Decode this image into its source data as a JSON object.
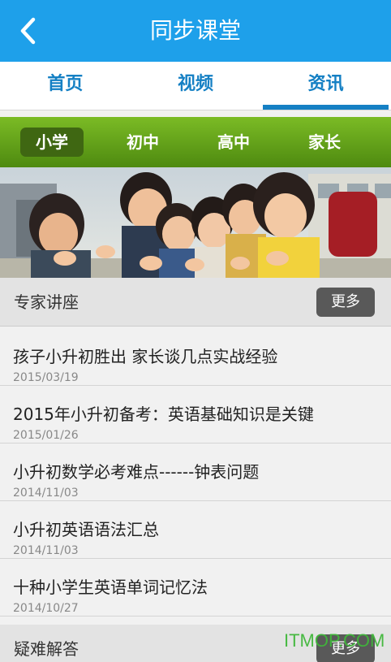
{
  "header": {
    "title": "同步课堂",
    "back_icon": "chevron-left-icon"
  },
  "tabs": [
    {
      "label": "首页",
      "active": false
    },
    {
      "label": "视频",
      "active": false
    },
    {
      "label": "资讯",
      "active": true
    }
  ],
  "segments": [
    {
      "label": "小学",
      "active": true
    },
    {
      "label": "初中",
      "active": false
    },
    {
      "label": "高中",
      "active": false
    },
    {
      "label": "家长",
      "active": false
    }
  ],
  "sections": {
    "expert": {
      "label": "专家讲座",
      "more_label": "更多"
    },
    "qa": {
      "label": "疑难解答",
      "more_label": "更多"
    }
  },
  "news": [
    {
      "title": "孩子小升初胜出 家长谈几点实战经验",
      "date": "2015/03/19"
    },
    {
      "title": "2015年小升初备考：英语基础知识是关键",
      "date": "2015/01/26"
    },
    {
      "title": "小升初数学必考难点------钟表问题",
      "date": "2014/11/03"
    },
    {
      "title": "小升初英语语法汇总",
      "date": "2014/11/03"
    },
    {
      "title": "十种小学生英语单词记忆法",
      "date": "2014/10/27"
    }
  ],
  "watermark": "ITMOP.COM",
  "colors": {
    "title_bar": "#1ea0ea",
    "tab_text": "#1580c4",
    "segment_bar": "#6aab1c",
    "segment_active": "#3f6712",
    "more_button": "#595959"
  }
}
